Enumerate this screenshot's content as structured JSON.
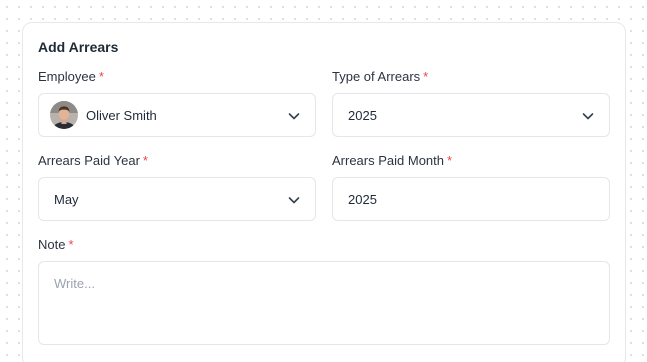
{
  "form": {
    "title": "Add Arrears",
    "required_mark": "*",
    "employee": {
      "label": "Employee",
      "value": "Oliver Smith"
    },
    "type_of_arrears": {
      "label": "Type of Arrears",
      "value": "2025"
    },
    "arrears_paid_year": {
      "label": "Arrears Paid Year",
      "value": "May"
    },
    "arrears_paid_month": {
      "label": "Arrears Paid Month",
      "value": "2025"
    },
    "note": {
      "label": "Note",
      "placeholder": "Write..."
    }
  },
  "icons": {
    "dropdown": "chevron-down-icon",
    "avatar": "user-avatar"
  },
  "colors": {
    "required": "#ef4444",
    "border": "#e4e6eb",
    "text": "#1f2937",
    "placeholder": "#9ca3af"
  }
}
